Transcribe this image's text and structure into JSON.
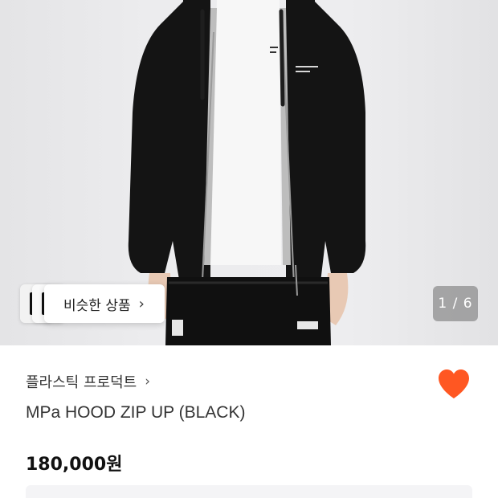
{
  "product": {
    "brand": "플라스틱 프로덕트",
    "name": "MPa HOOD ZIP UP (BLACK)",
    "price": "180,000원"
  },
  "gallery": {
    "counter": "1 / 6",
    "similar_label": "비슷한 상품"
  },
  "icons": {
    "similar_chevron": "chevron-right-icon",
    "brand_chevron": "chevron-right-icon",
    "like": "heart-icon"
  },
  "colors": {
    "heart": "#ff5722",
    "garment": "#111111"
  }
}
